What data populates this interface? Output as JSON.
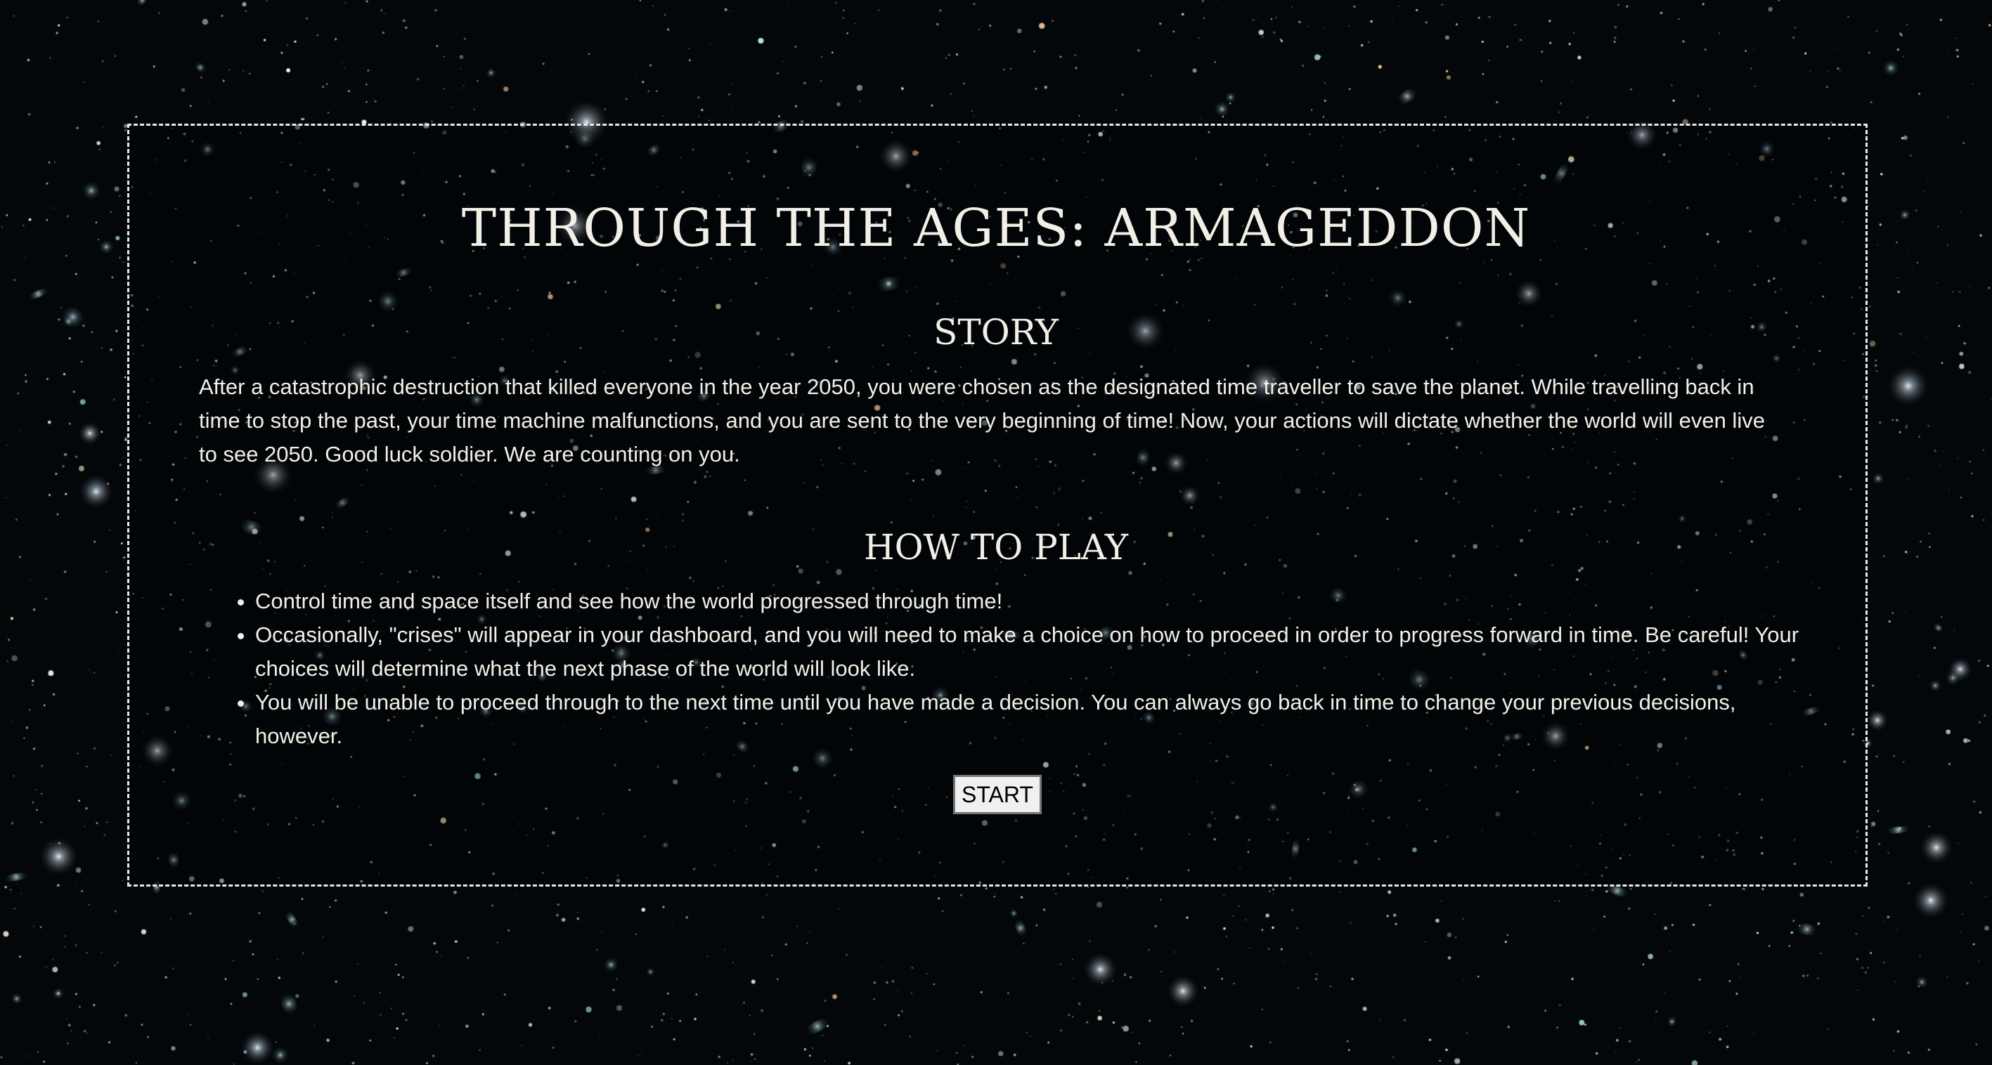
{
  "page": {
    "title": "THROUGH THE AGES: ARMAGEDDON",
    "background": "starfield"
  },
  "story": {
    "heading": "STORY",
    "text": "After a catastrophic destruction that killed everyone in the year 2050, you were chosen as the designated time traveller to save the planet. While travelling back in time to stop the past, your time machine malfunctions, and you are sent to the very beginning of time! Now, your actions will dictate whether the world will even live to see 2050. Good luck soldier. We are counting on you."
  },
  "how_to_play": {
    "heading": "HOW TO PLAY",
    "items": [
      "Control time and space itself and see how the world progressed through time!",
      "Occasionally, \"crises\" will appear in your dashboard, and you will need to make a choice on how to proceed in order to progress forward in time. Be careful! Your choices will determine what the next phase of the world will look like.",
      "You will be unable to proceed through to the next time until you have made a decision. You can always go back in time to change your previous decisions, however."
    ]
  },
  "start_button": {
    "label": "START"
  },
  "colors": {
    "background": "#05080b",
    "text": "#f2efe7",
    "frame_border": "#e8e8e8",
    "button_bg": "#f0f0f0"
  }
}
